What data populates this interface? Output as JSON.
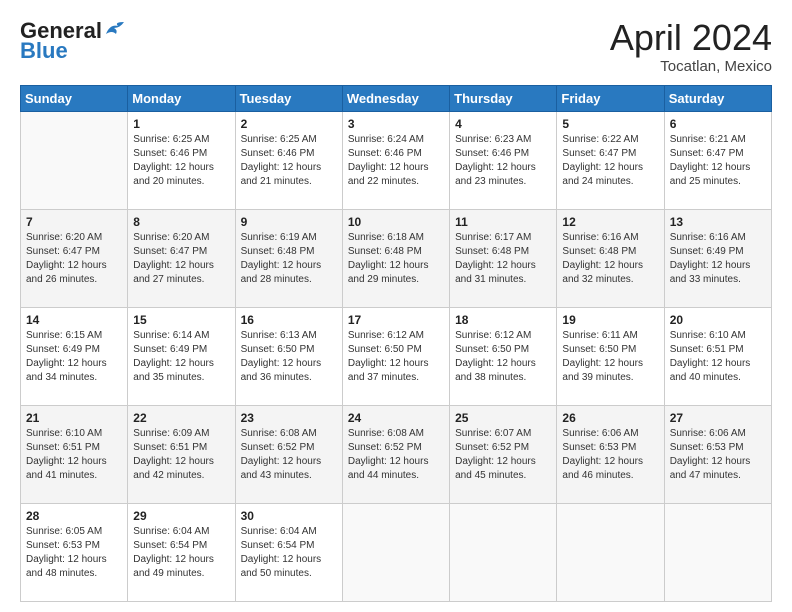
{
  "logo": {
    "general": "General",
    "blue": "Blue"
  },
  "title": "April 2024",
  "location": "Tocatlan, Mexico",
  "days_header": [
    "Sunday",
    "Monday",
    "Tuesday",
    "Wednesday",
    "Thursday",
    "Friday",
    "Saturday"
  ],
  "weeks": [
    [
      {
        "day": "",
        "sunrise": "",
        "sunset": "",
        "daylight": ""
      },
      {
        "day": "1",
        "sunrise": "Sunrise: 6:25 AM",
        "sunset": "Sunset: 6:46 PM",
        "daylight": "Daylight: 12 hours and 20 minutes."
      },
      {
        "day": "2",
        "sunrise": "Sunrise: 6:25 AM",
        "sunset": "Sunset: 6:46 PM",
        "daylight": "Daylight: 12 hours and 21 minutes."
      },
      {
        "day": "3",
        "sunrise": "Sunrise: 6:24 AM",
        "sunset": "Sunset: 6:46 PM",
        "daylight": "Daylight: 12 hours and 22 minutes."
      },
      {
        "day": "4",
        "sunrise": "Sunrise: 6:23 AM",
        "sunset": "Sunset: 6:46 PM",
        "daylight": "Daylight: 12 hours and 23 minutes."
      },
      {
        "day": "5",
        "sunrise": "Sunrise: 6:22 AM",
        "sunset": "Sunset: 6:47 PM",
        "daylight": "Daylight: 12 hours and 24 minutes."
      },
      {
        "day": "6",
        "sunrise": "Sunrise: 6:21 AM",
        "sunset": "Sunset: 6:47 PM",
        "daylight": "Daylight: 12 hours and 25 minutes."
      }
    ],
    [
      {
        "day": "7",
        "sunrise": "Sunrise: 6:20 AM",
        "sunset": "Sunset: 6:47 PM",
        "daylight": "Daylight: 12 hours and 26 minutes."
      },
      {
        "day": "8",
        "sunrise": "Sunrise: 6:20 AM",
        "sunset": "Sunset: 6:47 PM",
        "daylight": "Daylight: 12 hours and 27 minutes."
      },
      {
        "day": "9",
        "sunrise": "Sunrise: 6:19 AM",
        "sunset": "Sunset: 6:48 PM",
        "daylight": "Daylight: 12 hours and 28 minutes."
      },
      {
        "day": "10",
        "sunrise": "Sunrise: 6:18 AM",
        "sunset": "Sunset: 6:48 PM",
        "daylight": "Daylight: 12 hours and 29 minutes."
      },
      {
        "day": "11",
        "sunrise": "Sunrise: 6:17 AM",
        "sunset": "Sunset: 6:48 PM",
        "daylight": "Daylight: 12 hours and 31 minutes."
      },
      {
        "day": "12",
        "sunrise": "Sunrise: 6:16 AM",
        "sunset": "Sunset: 6:48 PM",
        "daylight": "Daylight: 12 hours and 32 minutes."
      },
      {
        "day": "13",
        "sunrise": "Sunrise: 6:16 AM",
        "sunset": "Sunset: 6:49 PM",
        "daylight": "Daylight: 12 hours and 33 minutes."
      }
    ],
    [
      {
        "day": "14",
        "sunrise": "Sunrise: 6:15 AM",
        "sunset": "Sunset: 6:49 PM",
        "daylight": "Daylight: 12 hours and 34 minutes."
      },
      {
        "day": "15",
        "sunrise": "Sunrise: 6:14 AM",
        "sunset": "Sunset: 6:49 PM",
        "daylight": "Daylight: 12 hours and 35 minutes."
      },
      {
        "day": "16",
        "sunrise": "Sunrise: 6:13 AM",
        "sunset": "Sunset: 6:50 PM",
        "daylight": "Daylight: 12 hours and 36 minutes."
      },
      {
        "day": "17",
        "sunrise": "Sunrise: 6:12 AM",
        "sunset": "Sunset: 6:50 PM",
        "daylight": "Daylight: 12 hours and 37 minutes."
      },
      {
        "day": "18",
        "sunrise": "Sunrise: 6:12 AM",
        "sunset": "Sunset: 6:50 PM",
        "daylight": "Daylight: 12 hours and 38 minutes."
      },
      {
        "day": "19",
        "sunrise": "Sunrise: 6:11 AM",
        "sunset": "Sunset: 6:50 PM",
        "daylight": "Daylight: 12 hours and 39 minutes."
      },
      {
        "day": "20",
        "sunrise": "Sunrise: 6:10 AM",
        "sunset": "Sunset: 6:51 PM",
        "daylight": "Daylight: 12 hours and 40 minutes."
      }
    ],
    [
      {
        "day": "21",
        "sunrise": "Sunrise: 6:10 AM",
        "sunset": "Sunset: 6:51 PM",
        "daylight": "Daylight: 12 hours and 41 minutes."
      },
      {
        "day": "22",
        "sunrise": "Sunrise: 6:09 AM",
        "sunset": "Sunset: 6:51 PM",
        "daylight": "Daylight: 12 hours and 42 minutes."
      },
      {
        "day": "23",
        "sunrise": "Sunrise: 6:08 AM",
        "sunset": "Sunset: 6:52 PM",
        "daylight": "Daylight: 12 hours and 43 minutes."
      },
      {
        "day": "24",
        "sunrise": "Sunrise: 6:08 AM",
        "sunset": "Sunset: 6:52 PM",
        "daylight": "Daylight: 12 hours and 44 minutes."
      },
      {
        "day": "25",
        "sunrise": "Sunrise: 6:07 AM",
        "sunset": "Sunset: 6:52 PM",
        "daylight": "Daylight: 12 hours and 45 minutes."
      },
      {
        "day": "26",
        "sunrise": "Sunrise: 6:06 AM",
        "sunset": "Sunset: 6:53 PM",
        "daylight": "Daylight: 12 hours and 46 minutes."
      },
      {
        "day": "27",
        "sunrise": "Sunrise: 6:06 AM",
        "sunset": "Sunset: 6:53 PM",
        "daylight": "Daylight: 12 hours and 47 minutes."
      }
    ],
    [
      {
        "day": "28",
        "sunrise": "Sunrise: 6:05 AM",
        "sunset": "Sunset: 6:53 PM",
        "daylight": "Daylight: 12 hours and 48 minutes."
      },
      {
        "day": "29",
        "sunrise": "Sunrise: 6:04 AM",
        "sunset": "Sunset: 6:54 PM",
        "daylight": "Daylight: 12 hours and 49 minutes."
      },
      {
        "day": "30",
        "sunrise": "Sunrise: 6:04 AM",
        "sunset": "Sunset: 6:54 PM",
        "daylight": "Daylight: 12 hours and 50 minutes."
      },
      {
        "day": "",
        "sunrise": "",
        "sunset": "",
        "daylight": ""
      },
      {
        "day": "",
        "sunrise": "",
        "sunset": "",
        "daylight": ""
      },
      {
        "day": "",
        "sunrise": "",
        "sunset": "",
        "daylight": ""
      },
      {
        "day": "",
        "sunrise": "",
        "sunset": "",
        "daylight": ""
      }
    ]
  ]
}
